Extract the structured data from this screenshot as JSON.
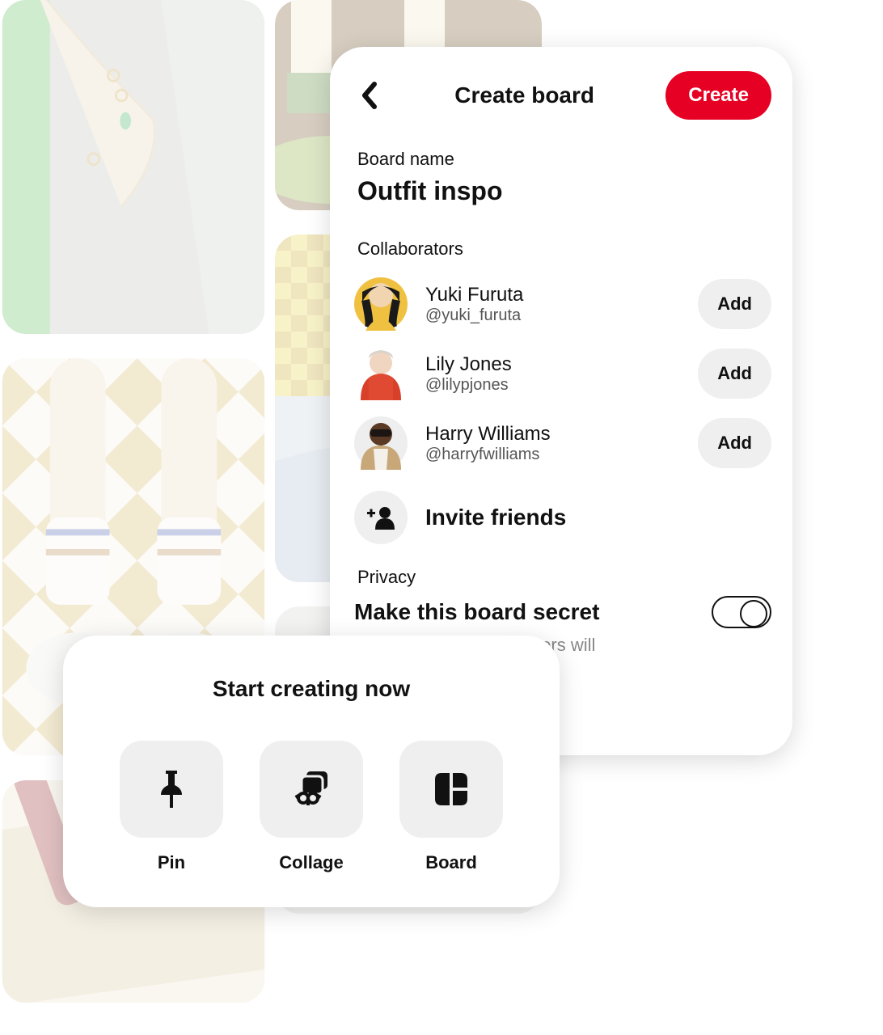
{
  "panel": {
    "title": "Create board",
    "create_button": "Create",
    "board_name_label": "Board name",
    "board_name_value": "Outfit inspo",
    "collaborators_label": "Collaborators",
    "add_label": "Add",
    "collaborators": [
      {
        "name": "Yuki Furuta",
        "handle": "@yuki_furuta"
      },
      {
        "name": "Lily Jones",
        "handle": "@lilypjones"
      },
      {
        "name": "Harry Williams",
        "handle": "@harryfwilliams"
      }
    ],
    "invite_label": "Invite friends",
    "privacy_label": "Privacy",
    "privacy_title": "Make this board secret",
    "privacy_sub": "Only you and collaborators will"
  },
  "popup": {
    "title": "Start creating now",
    "items": [
      {
        "label": "Pin"
      },
      {
        "label": "Collage"
      },
      {
        "label": "Board"
      }
    ]
  }
}
